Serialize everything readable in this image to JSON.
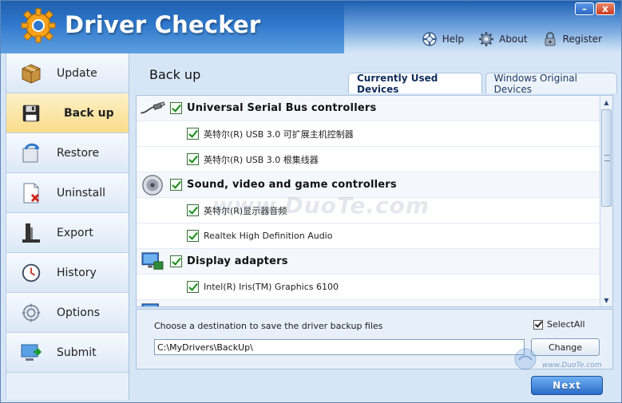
{
  "window": {
    "title": "Driver Checker",
    "minimize_glyph": "–",
    "close_glyph": "x"
  },
  "header": {
    "links": [
      {
        "label": "Help",
        "icon": "lifebuoy-icon"
      },
      {
        "label": "About",
        "icon": "gear-icon"
      },
      {
        "label": "Register",
        "icon": "lock-icon"
      }
    ]
  },
  "sidebar": {
    "items": [
      {
        "label": "Update",
        "icon": "box-icon",
        "active": false
      },
      {
        "label": "Back up",
        "icon": "floppy-icon",
        "active": true
      },
      {
        "label": "Restore",
        "icon": "restore-icon",
        "active": false
      },
      {
        "label": "Uninstall",
        "icon": "uninstall-icon",
        "active": false
      },
      {
        "label": "Export",
        "icon": "export-icon",
        "active": false
      },
      {
        "label": "History",
        "icon": "clock-icon",
        "active": false
      },
      {
        "label": "Options",
        "icon": "options-icon",
        "active": false
      },
      {
        "label": "Submit",
        "icon": "submit-icon",
        "active": false
      }
    ]
  },
  "main": {
    "title": "Back up",
    "tabs": [
      {
        "label": "Currently Used Devices",
        "active": true
      },
      {
        "label": "Windows Original Devices",
        "active": false
      }
    ],
    "groups": [
      {
        "name": "Universal Serial Bus controllers",
        "icon": "usb-cable-icon",
        "checked": true,
        "devices": [
          {
            "name": "英特尔(R) USB 3.0 可扩展主机控制器",
            "checked": true
          },
          {
            "name": "英特尔(R) USB 3.0 根集线器",
            "checked": true
          }
        ]
      },
      {
        "name": "Sound, video and game controllers",
        "icon": "speaker-icon",
        "checked": true,
        "devices": [
          {
            "name": "英特尔(R)显示器音频",
            "checked": true
          },
          {
            "name": "Realtek High Definition Audio",
            "checked": true
          }
        ]
      },
      {
        "name": "Display adapters",
        "icon": "monitor-icon",
        "checked": true,
        "devices": [
          {
            "name": "Intel(R) Iris(TM) Graphics 6100",
            "checked": true
          }
        ]
      }
    ],
    "destination_label": "Choose a destination to save the driver backup files",
    "destination_path": "C:\\MyDrivers\\BackUp\\",
    "select_all_label": "SelectAll",
    "select_all_checked": true,
    "change_label": "Change",
    "next_label": "Next"
  },
  "watermark": {
    "center_text": "www.DuoTe.com",
    "corner_site": "www.DuoTe.com"
  },
  "colors": {
    "header_top": "#1f5fb0",
    "active_nav": "#f9dc8a",
    "check_green": "#178a17",
    "next_button": "#2a6bc9"
  }
}
